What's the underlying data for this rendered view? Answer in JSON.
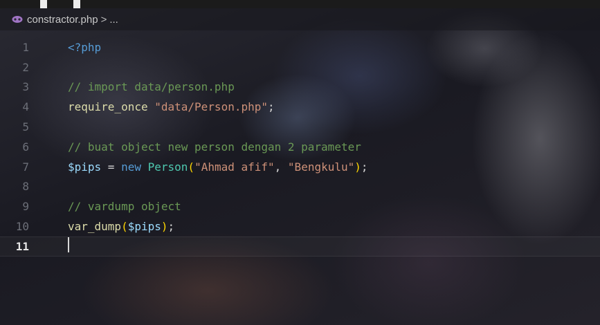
{
  "breadcrumb": {
    "file_name": "constractor.php",
    "separator": ">",
    "trailing": "..."
  },
  "editor": {
    "current_line": 11,
    "lines": [
      {
        "number": "1",
        "tokens": [
          {
            "t": "<?php",
            "c": "tag"
          }
        ]
      },
      {
        "number": "2",
        "tokens": []
      },
      {
        "number": "3",
        "tokens": [
          {
            "t": "// import data/person.php",
            "c": "comment"
          }
        ]
      },
      {
        "number": "4",
        "tokens": [
          {
            "t": "require_once",
            "c": "func"
          },
          {
            "t": " ",
            "c": "punc"
          },
          {
            "t": "\"data/Person.php\"",
            "c": "str"
          },
          {
            "t": ";",
            "c": "punc"
          }
        ]
      },
      {
        "number": "5",
        "tokens": []
      },
      {
        "number": "6",
        "tokens": [
          {
            "t": "// buat object new person dengan 2 parameter",
            "c": "comment"
          }
        ]
      },
      {
        "number": "7",
        "tokens": [
          {
            "t": "$pips",
            "c": "var"
          },
          {
            "t": " = ",
            "c": "punc"
          },
          {
            "t": "new",
            "c": "kw"
          },
          {
            "t": " ",
            "c": "punc"
          },
          {
            "t": "Person",
            "c": "class"
          },
          {
            "t": "(",
            "c": "paren"
          },
          {
            "t": "\"Ahmad afif\"",
            "c": "str"
          },
          {
            "t": ", ",
            "c": "punc"
          },
          {
            "t": "\"Bengkulu\"",
            "c": "str"
          },
          {
            "t": ")",
            "c": "paren"
          },
          {
            "t": ";",
            "c": "punc"
          }
        ]
      },
      {
        "number": "8",
        "tokens": []
      },
      {
        "number": "9",
        "tokens": [
          {
            "t": "// vardump object",
            "c": "comment"
          }
        ]
      },
      {
        "number": "10",
        "tokens": [
          {
            "t": "var_dump",
            "c": "func"
          },
          {
            "t": "(",
            "c": "paren"
          },
          {
            "t": "$pips",
            "c": "var"
          },
          {
            "t": ")",
            "c": "paren"
          },
          {
            "t": ";",
            "c": "punc"
          }
        ]
      },
      {
        "number": "11",
        "tokens": []
      }
    ]
  },
  "colors": {
    "comment": "#6a9955",
    "string": "#ce9178",
    "variable": "#9cdcfe",
    "keyword": "#569cd6",
    "class": "#4ec9b0",
    "function": "#dcdcaa",
    "bracket": "#ffd700"
  }
}
